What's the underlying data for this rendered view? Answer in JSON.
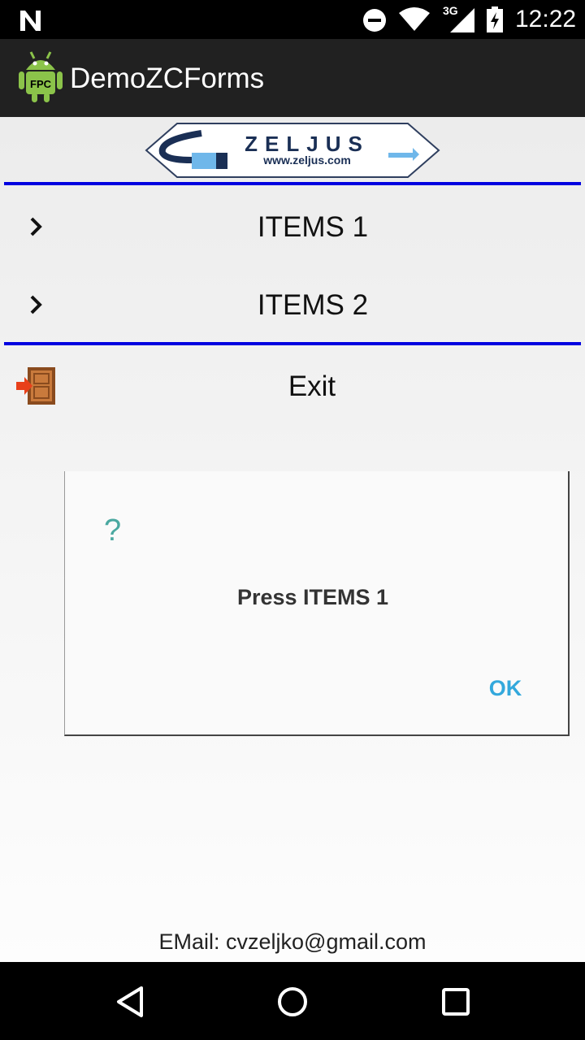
{
  "status_bar": {
    "network_type": "3G",
    "time": "12:22",
    "icons": [
      "n-icon",
      "dnd-icon",
      "wifi-icon",
      "cell-signal-icon",
      "battery-charging-icon"
    ]
  },
  "app_bar": {
    "title": "DemoZCForms",
    "icon_label": "FPC"
  },
  "logo": {
    "name": "ZELJUS",
    "url_text": "www.zeljus.com"
  },
  "menu": {
    "items": [
      {
        "label": "ITEMS 1",
        "icon": "chevron-right-icon"
      },
      {
        "label": "ITEMS 2",
        "icon": "chevron-right-icon"
      }
    ],
    "exit": {
      "label": "Exit",
      "icon": "exit-door-icon"
    },
    "divider_color": "#0000e0"
  },
  "dialog": {
    "icon": "?",
    "message": "Press ITEMS 1",
    "ok_label": "OK",
    "ok_color": "#33a8dc"
  },
  "footer": {
    "email": "EMail: cvzeljko@gmail.com"
  },
  "nav_bar": {
    "icons": [
      "back-icon",
      "home-icon",
      "recents-icon"
    ]
  }
}
